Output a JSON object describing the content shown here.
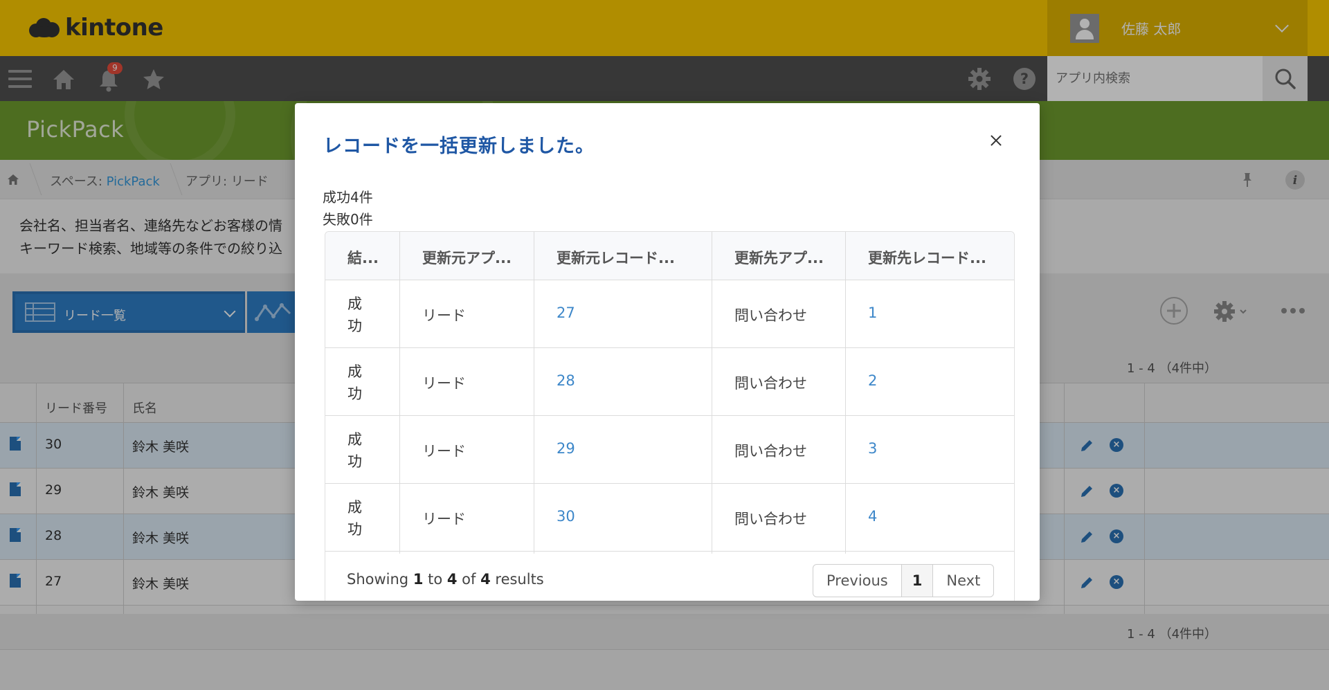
{
  "header": {
    "logo_text": "kintone",
    "user_name": "佐藤 太郎",
    "search_placeholder": "アプリ内検索",
    "notification_count": "9"
  },
  "space": {
    "title": "PickPack"
  },
  "breadcrumb": {
    "space_prefix": "スペース: ",
    "space_name": "PickPack",
    "app_label": "アプリ: リード"
  },
  "description": {
    "line1": "会社名、担当者名、連絡先などお客様の情",
    "line2": "キーワード検索、地域等の条件での絞り込"
  },
  "view": {
    "selected": "リード一覧",
    "count_top": "1 - 4 （4件中）",
    "count_bottom": "1 - 4 （4件中）"
  },
  "list": {
    "columns": [
      "リード番号",
      "氏名"
    ],
    "rows": [
      {
        "num": "30",
        "name": "鈴木 美咲"
      },
      {
        "num": "29",
        "name": "鈴木 美咲"
      },
      {
        "num": "28",
        "name": "鈴木 美咲"
      },
      {
        "num": "27",
        "name": "鈴木 美咲"
      }
    ]
  },
  "modal": {
    "title": "レコードを一括更新しました。",
    "success": "成功4件",
    "failure": "失敗0件",
    "columns": [
      "結...",
      "更新元アプ...",
      "更新元レコード...",
      "更新先アプ...",
      "更新先レコード..."
    ],
    "rows": [
      {
        "result": "成功",
        "src_app": "リード",
        "src_record": "27",
        "dst_app": "問い合わせ",
        "dst_record": "1"
      },
      {
        "result": "成功",
        "src_app": "リード",
        "src_record": "28",
        "dst_app": "問い合わせ",
        "dst_record": "2"
      },
      {
        "result": "成功",
        "src_app": "リード",
        "src_record": "29",
        "dst_app": "問い合わせ",
        "dst_record": "3"
      },
      {
        "result": "成功",
        "src_app": "リード",
        "src_record": "30",
        "dst_app": "問い合わせ",
        "dst_record": "4"
      }
    ],
    "showing": {
      "prefix": "Showing ",
      "from": "1",
      "to_word": " to ",
      "to": "4",
      "of_word": " of ",
      "total": "4",
      "suffix": " results"
    },
    "pager": {
      "previous": "Previous",
      "current": "1",
      "next": "Next"
    }
  },
  "colors": {
    "header_yellow": "#fccb00",
    "nav_dark": "#4f4f4f",
    "banner_green": "#6f9d2e",
    "accent_blue": "#2a72b5",
    "modal_title": "#1f57a4"
  }
}
